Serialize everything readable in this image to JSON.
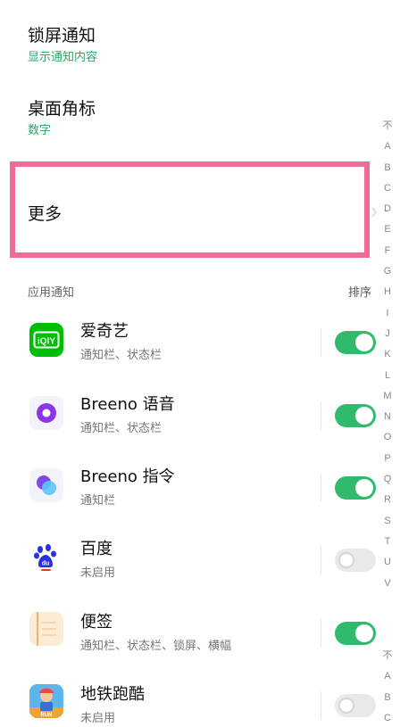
{
  "settings": {
    "lock_screen": {
      "title": "锁屏通知",
      "value": "显示通知内容"
    },
    "badge": {
      "title": "桌面角标",
      "value": "数字"
    },
    "more": {
      "title": "更多"
    }
  },
  "section": {
    "title": "应用通知",
    "sort_label": "排序"
  },
  "apps": [
    {
      "name": "爱奇艺",
      "status": "通知栏、状态栏",
      "enabled": true,
      "icon": "iqiyi-icon",
      "color": "#00be06"
    },
    {
      "name": "Breeno 语音",
      "status": "通知栏、状态栏",
      "enabled": true,
      "icon": "breeno-voice-icon",
      "color": "#7b3fe4"
    },
    {
      "name": "Breeno 指令",
      "status": "通知栏",
      "enabled": true,
      "icon": "breeno-command-icon",
      "color": "#5b7cfa"
    },
    {
      "name": "百度",
      "status": "未启用",
      "enabled": false,
      "icon": "baidu-icon",
      "color": "#2932e1"
    },
    {
      "name": "便签",
      "status": "通知栏、状态栏、锁屏、横幅",
      "enabled": true,
      "icon": "notes-icon",
      "color": "#f5c98a"
    },
    {
      "name": "地铁跑酷",
      "status": "未启用",
      "enabled": false,
      "icon": "subway-surfers-icon",
      "color": "#e94b3c"
    }
  ],
  "alphabet_index": [
    "不",
    "A",
    "B",
    "C",
    "D",
    "E",
    "F",
    "G",
    "H",
    "I",
    "J",
    "K",
    "L",
    "M",
    "N",
    "O",
    "P",
    "Q",
    "R",
    "S",
    "T",
    "U",
    "V"
  ],
  "alphabet_index_bottom": [
    "不",
    "A",
    "B",
    "C"
  ],
  "colors": {
    "accent": "#2fbb6b",
    "highlight": "#f06b98"
  }
}
